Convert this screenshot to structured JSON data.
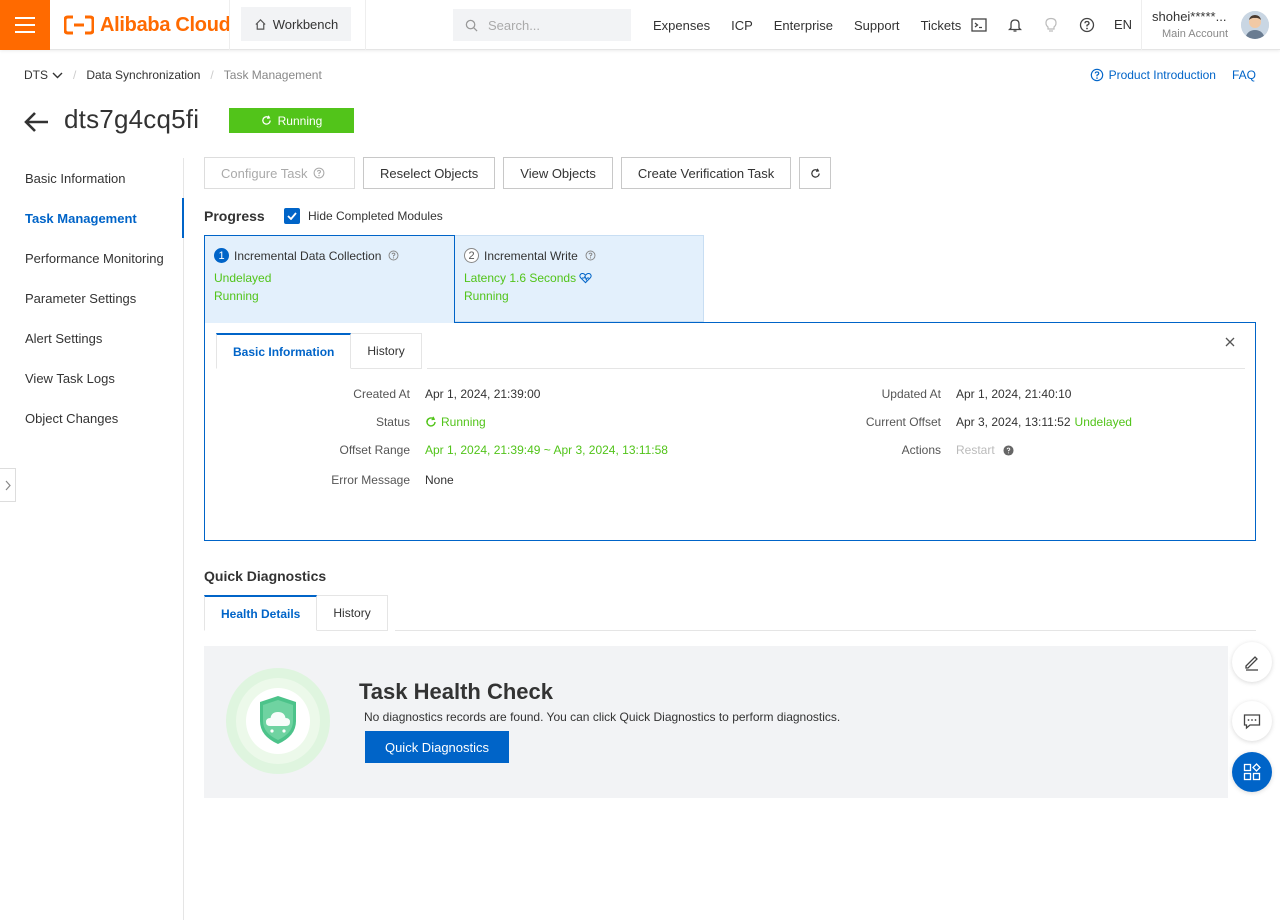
{
  "topbar": {
    "brand": "Alibaba Cloud",
    "workbench": "Workbench",
    "search_placeholder": "Search...",
    "nav": [
      "Expenses",
      "ICP",
      "Enterprise",
      "Support",
      "Tickets"
    ],
    "lang": "EN",
    "username": "shohei*****...",
    "role": "Main Account"
  },
  "breadcrumb": {
    "service": "DTS",
    "section": "Data Synchronization",
    "current": "Task Management"
  },
  "top_links": {
    "product_intro": "Product Introduction",
    "faq": "FAQ"
  },
  "page": {
    "title": "dts7g4cq5fi",
    "status": "Running"
  },
  "sidebar": {
    "items": [
      {
        "label": "Basic Information"
      },
      {
        "label": "Task Management"
      },
      {
        "label": "Performance Monitoring"
      },
      {
        "label": "Parameter Settings"
      },
      {
        "label": "Alert Settings"
      },
      {
        "label": "View Task Logs"
      },
      {
        "label": "Object Changes"
      }
    ]
  },
  "toolbar": {
    "configure": "Configure Task",
    "reselect": "Reselect Objects",
    "view": "View Objects",
    "verify": "Create Verification Task"
  },
  "progress": {
    "label": "Progress",
    "hide_completed": "Hide Completed Modules",
    "modules": [
      {
        "num": "1",
        "title": "Incremental Data Collection",
        "line1": "Undelayed",
        "line2": "Running"
      },
      {
        "num": "2",
        "title": "Incremental Write",
        "line1": "Latency 1.6 Seconds",
        "line2": "Running"
      }
    ]
  },
  "detail": {
    "tabs": [
      "Basic Information",
      "History"
    ],
    "created_at_label": "Created At",
    "created_at": "Apr 1, 2024, 21:39:00",
    "status_label": "Status",
    "status": "Running",
    "offset_range_label": "Offset Range",
    "offset_range": "Apr 1, 2024, 21:39:49 ~ Apr 3, 2024, 13:11:58",
    "error_label": "Error Message",
    "error": "None",
    "updated_at_label": "Updated At",
    "updated_at": "Apr 1, 2024, 21:40:10",
    "current_offset_label": "Current Offset",
    "current_offset": "Apr 3, 2024, 13:11:52",
    "current_offset_status": "Undelayed",
    "actions_label": "Actions",
    "restart": "Restart"
  },
  "diagnostics": {
    "title": "Quick Diagnostics",
    "tabs": [
      "Health Details",
      "History"
    ],
    "check_title": "Task Health Check",
    "check_desc": "No diagnostics records are found. You can click Quick Diagnostics to perform diagnostics.",
    "button": "Quick Diagnostics"
  },
  "colors": {
    "brand": "#ff6a00",
    "primary": "#0064c8",
    "success": "#52c41a"
  }
}
